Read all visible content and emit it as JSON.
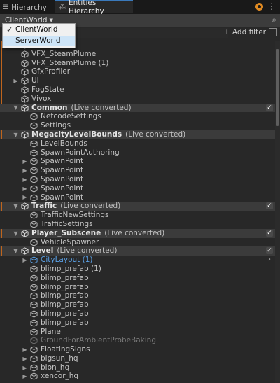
{
  "tabs": {
    "hierarchy": "Hierarchy",
    "entities": "Entities Hierarchy"
  },
  "toolbar": {
    "world": "ClientWorld"
  },
  "filter": {
    "add_filter": "+ Add filter",
    "search_placeholder": ""
  },
  "dropdown": {
    "options": [
      "ClientWorld",
      "ServerWorld"
    ],
    "selected": "ClientWorld"
  },
  "rows": [
    {
      "label": "",
      "indent": 1,
      "arrow": "",
      "marker": true
    },
    {
      "label": "VFX_SteamPlume",
      "indent": 1,
      "arrow": "",
      "marker": true
    },
    {
      "label": "VFX_SteamPlume (1)",
      "indent": 1,
      "arrow": "",
      "marker": true
    },
    {
      "label": "GfxProfiler",
      "indent": 1,
      "arrow": "",
      "marker": true
    },
    {
      "label": "UI",
      "indent": 1,
      "arrow": "right",
      "marker": true
    },
    {
      "label": "FogState",
      "indent": 1,
      "arrow": "",
      "marker": true
    },
    {
      "label": "Vivox",
      "indent": 1,
      "arrow": "",
      "marker": true
    },
    {
      "label": "Common",
      "sub": "(Live converted)",
      "indent": 1,
      "arrow": "down",
      "header": true,
      "check": true
    },
    {
      "label": "NetcodeSettings",
      "indent": 2,
      "arrow": ""
    },
    {
      "label": "Settings",
      "indent": 2,
      "arrow": ""
    },
    {
      "label": "MegacityLevelBounds",
      "sub": "(Live converted)",
      "indent": 1,
      "arrow": "down",
      "header": true,
      "marker": true
    },
    {
      "label": "LevelBounds",
      "indent": 2,
      "arrow": ""
    },
    {
      "label": "SpawnPointAuthoring",
      "indent": 2,
      "arrow": ""
    },
    {
      "label": "SpawnPoint",
      "indent": 2,
      "arrow": "right"
    },
    {
      "label": "SpawnPoint",
      "indent": 2,
      "arrow": "right"
    },
    {
      "label": "SpawnPoint",
      "indent": 2,
      "arrow": "right"
    },
    {
      "label": "SpawnPoint",
      "indent": 2,
      "arrow": "right"
    },
    {
      "label": "SpawnPoint",
      "indent": 2,
      "arrow": "right"
    },
    {
      "label": "Traffic",
      "sub": "(Live converted)",
      "indent": 1,
      "arrow": "down",
      "header": true,
      "check": true,
      "marker": true
    },
    {
      "label": "TrafficNewSettings",
      "indent": 2,
      "arrow": ""
    },
    {
      "label": "TrafficSettings",
      "indent": 2,
      "arrow": ""
    },
    {
      "label": "Player_Subscene",
      "sub": "(Live converted)",
      "indent": 1,
      "arrow": "down",
      "header": true,
      "check": true,
      "marker": true
    },
    {
      "label": "VehicleSpawner",
      "indent": 2,
      "arrow": ""
    },
    {
      "label": "Level",
      "sub": "(Live converted)",
      "indent": 1,
      "arrow": "down",
      "header": true,
      "check": true,
      "marker": true
    },
    {
      "label": "CityLayout (1)",
      "indent": 2,
      "arrow": "right",
      "blue": true,
      "chevron": true
    },
    {
      "label": "blimp_prefab (1)",
      "indent": 2,
      "arrow": ""
    },
    {
      "label": "blimp_prefab",
      "indent": 2,
      "arrow": ""
    },
    {
      "label": "blimp_prefab",
      "indent": 2,
      "arrow": ""
    },
    {
      "label": "blimp_prefab",
      "indent": 2,
      "arrow": ""
    },
    {
      "label": "blimp_prefab",
      "indent": 2,
      "arrow": ""
    },
    {
      "label": "blimp_prefab",
      "indent": 2,
      "arrow": ""
    },
    {
      "label": "blimp_prefab",
      "indent": 2,
      "arrow": ""
    },
    {
      "label": "Plane",
      "indent": 2,
      "arrow": ""
    },
    {
      "label": "GroundForAmbientProbeBaking",
      "indent": 2,
      "arrow": "",
      "disabled": true
    },
    {
      "label": "FloatingSigns",
      "indent": 2,
      "arrow": "right"
    },
    {
      "label": "bigsun_hq",
      "indent": 2,
      "arrow": "right"
    },
    {
      "label": "bion_hq",
      "indent": 2,
      "arrow": "right"
    },
    {
      "label": "xencor_hq",
      "indent": 2,
      "arrow": "right"
    }
  ]
}
